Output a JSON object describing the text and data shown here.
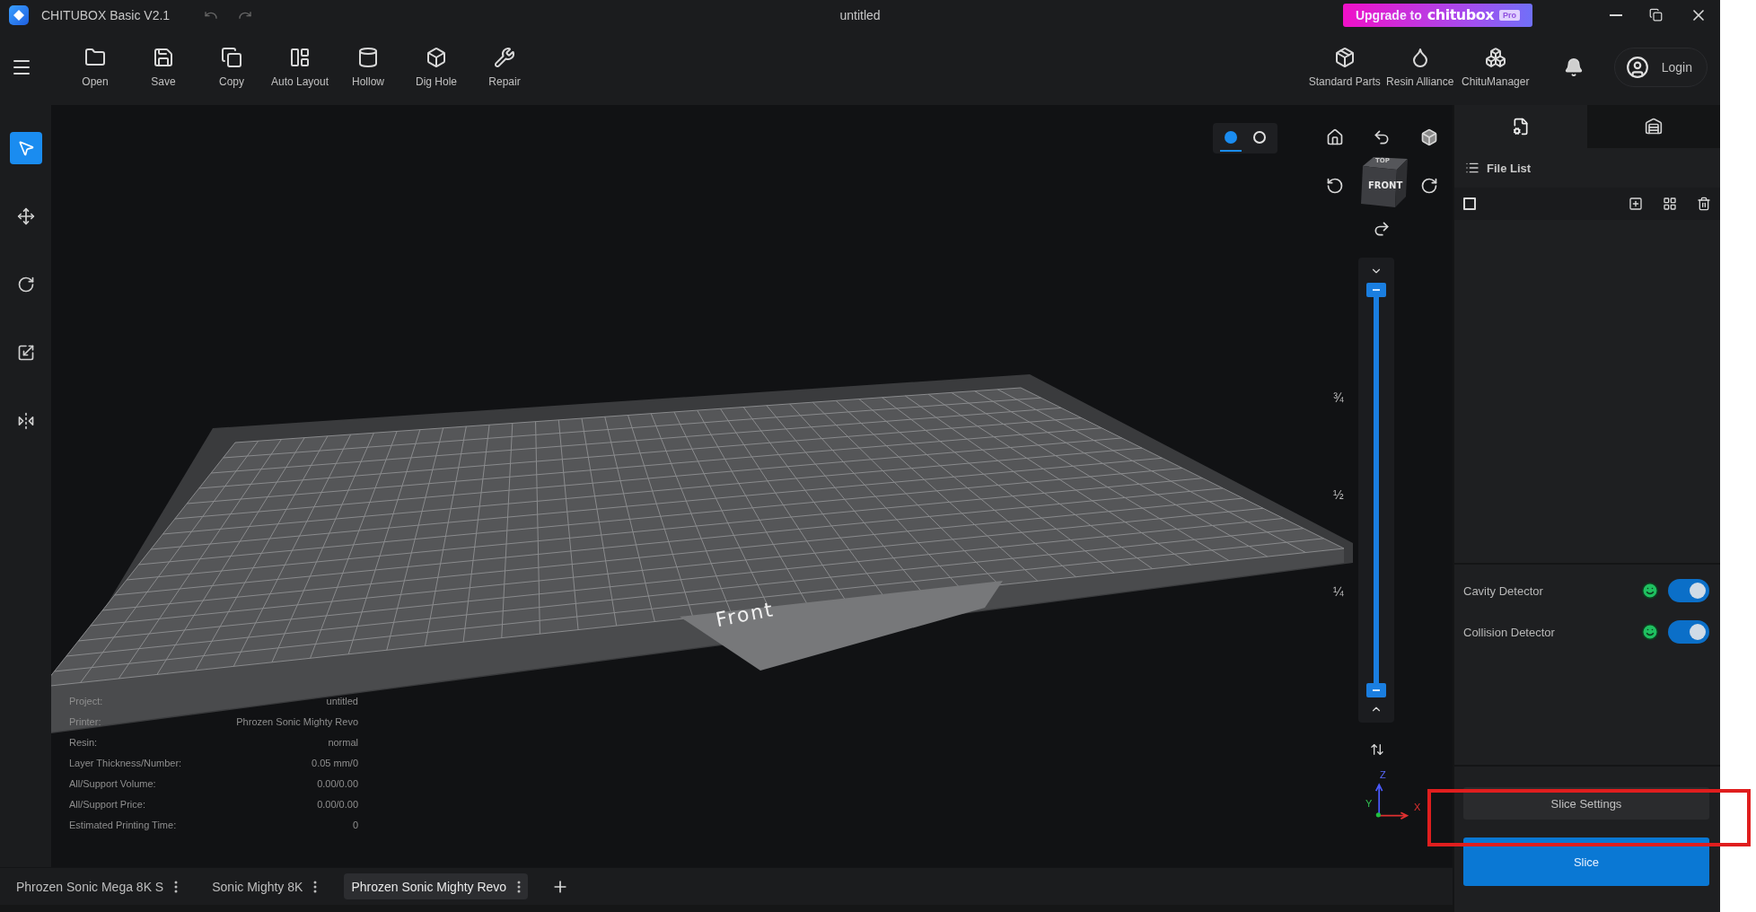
{
  "app": {
    "title": "CHITUBOX Basic V2.1"
  },
  "document_title": "untitled",
  "upgrade": {
    "label": "Upgrade to",
    "brand": "chitubox",
    "badge": "Pro"
  },
  "toolbar": {
    "tools": [
      {
        "label": "Open"
      },
      {
        "label": "Save"
      },
      {
        "label": "Copy"
      },
      {
        "label": "Auto Layout"
      },
      {
        "label": "Hollow"
      },
      {
        "label": "Dig Hole"
      },
      {
        "label": "Repair"
      }
    ],
    "right_tools": [
      {
        "label": "Standard Parts"
      },
      {
        "label": "Resin Alliance"
      },
      {
        "label": "ChituManager"
      }
    ],
    "login": "Login"
  },
  "left_tools": [
    {
      "selected": true
    },
    {
      "selected": false
    },
    {
      "selected": false
    },
    {
      "selected": false
    },
    {
      "selected": false
    }
  ],
  "view_modes": [
    {
      "selected": true
    },
    {
      "selected": false
    }
  ],
  "view_cube": {
    "front": "FRONT",
    "top": "TOP"
  },
  "layer_slider": {
    "level": 1,
    "marks": [
      "¾",
      "½",
      "¼"
    ]
  },
  "axes": [
    "X",
    "Y",
    "Z"
  ],
  "plate": {
    "label": "Front"
  },
  "info": [
    {
      "label": "Project:",
      "value": "untitled"
    },
    {
      "label": "Printer:",
      "value": "Phrozen Sonic Mighty Revo"
    },
    {
      "label": "Resin:",
      "value": "normal"
    },
    {
      "label": "Layer Thickness/Number:",
      "value": "0.05 mm/0"
    },
    {
      "label": "All/Support Volume:",
      "value": "0.00/0.00"
    },
    {
      "label": "All/Support Price:",
      "value": "0.00/0.00"
    },
    {
      "label": "Estimated Printing Time:",
      "value": "0"
    }
  ],
  "side_tabs": [
    {
      "selected": true
    },
    {
      "selected": false
    }
  ],
  "file_list": {
    "title": "File List",
    "select_all_checked": false
  },
  "detectors": [
    {
      "label": "Cavity Detector",
      "on": true
    },
    {
      "label": "Collision Detector",
      "on": true
    }
  ],
  "slice_settings": "Slice Settings",
  "slice": "Slice",
  "printer_tabs": [
    {
      "label": "Phrozen Sonic Mega 8K S",
      "selected": false
    },
    {
      "label": "Sonic Mighty 8K",
      "selected": false
    },
    {
      "label": "Phrozen Sonic Mighty Revo",
      "selected": true
    }
  ]
}
